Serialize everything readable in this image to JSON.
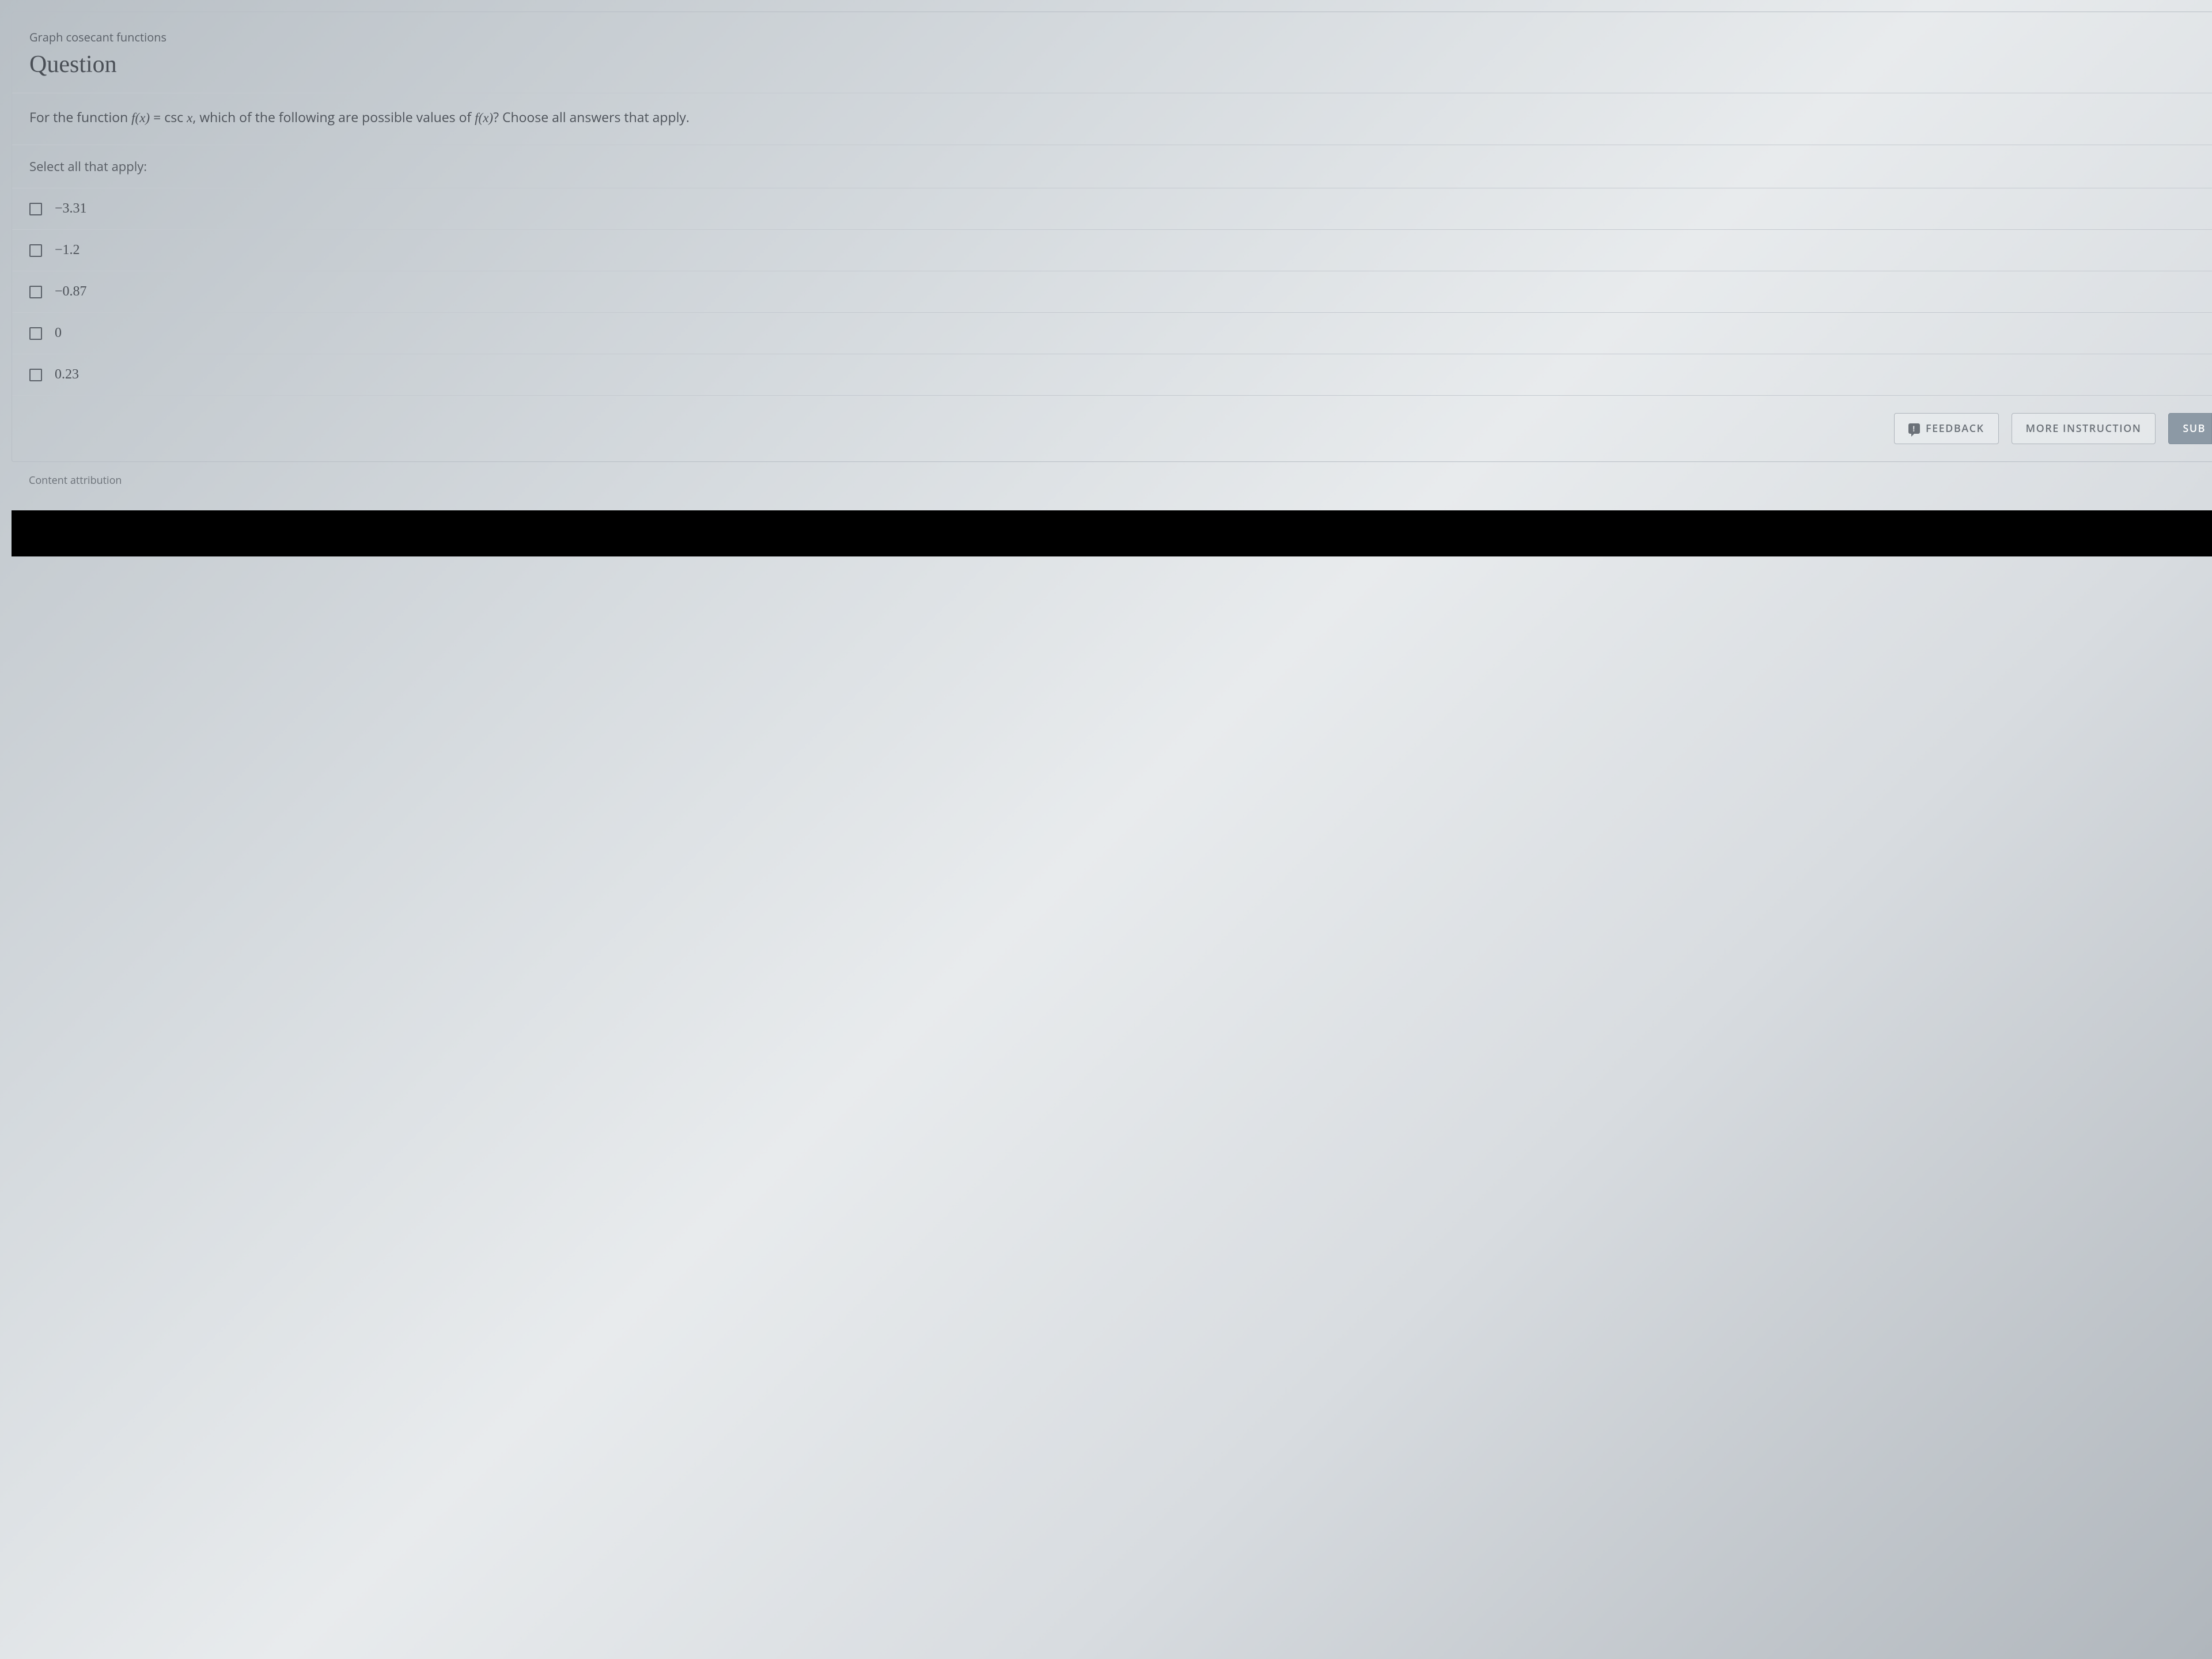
{
  "topic": "Graph cosecant functions",
  "title": "Question",
  "prompt_prefix": "For the function ",
  "prompt_fx": "f(x)",
  "prompt_eq": " = csc ",
  "prompt_var": "x",
  "prompt_mid": ", which of the following are possible values of ",
  "prompt_suffix": "? Choose all answers that apply.",
  "instruction": "Select all that apply:",
  "options": [
    {
      "label": "−3.31"
    },
    {
      "label": "−1.2"
    },
    {
      "label": "−0.87"
    },
    {
      "label": "0"
    },
    {
      "label": "0.23"
    }
  ],
  "buttons": {
    "feedback": "FEEDBACK",
    "more": "MORE INSTRUCTION",
    "submit": "SUB"
  },
  "attribution": "Content attribution"
}
